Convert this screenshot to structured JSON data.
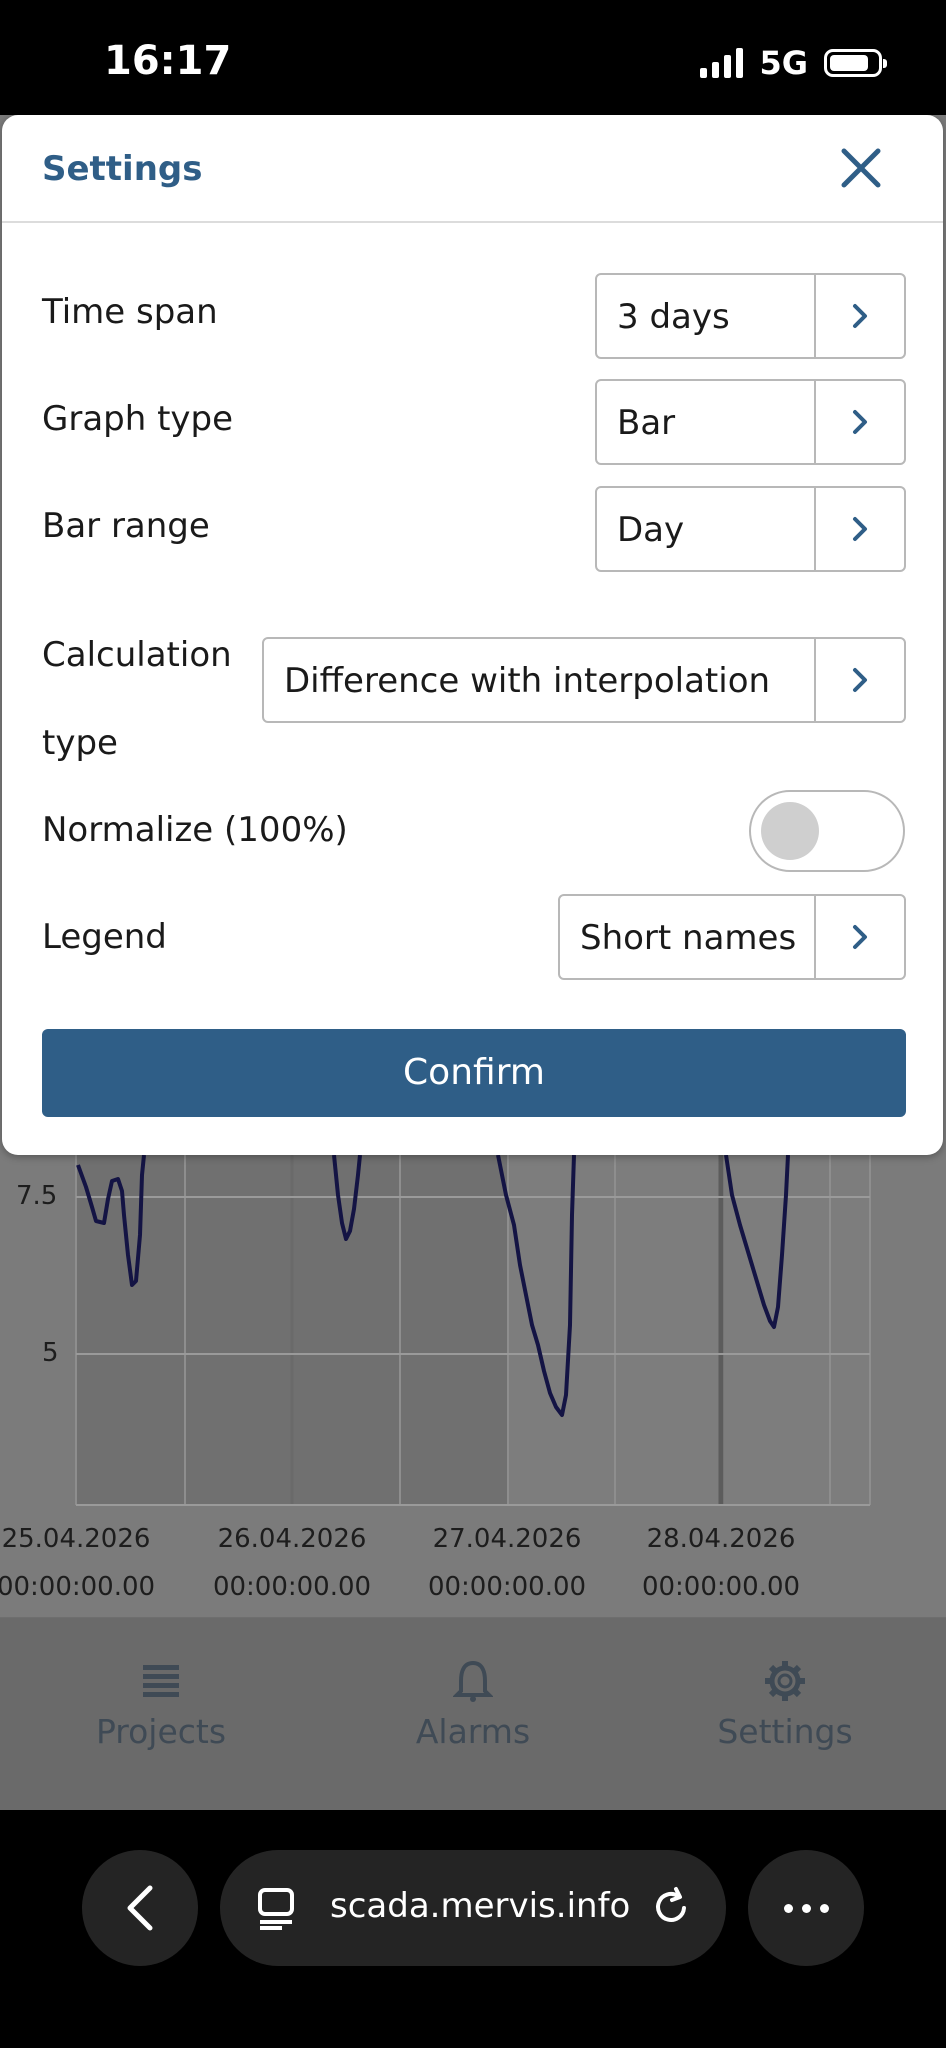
{
  "status_bar": {
    "time": "16:17",
    "network": "5G"
  },
  "settings_modal": {
    "title": "Settings",
    "rows": [
      {
        "label": "Time span",
        "value": "3 days"
      },
      {
        "label": "Graph type",
        "value": "Bar"
      },
      {
        "label": "Bar range",
        "value": "Day"
      },
      {
        "label": "Calculation type",
        "value": "Difference with interpolation"
      },
      {
        "label": "Normalize (100%)",
        "toggle_on": false
      },
      {
        "label": "Legend",
        "value": "Short names"
      }
    ],
    "confirm_label": "Confirm"
  },
  "chart": {
    "y_ticks": [
      "7.5",
      "5"
    ],
    "x_ticks": [
      {
        "date": "25.04.2026",
        "time": "00:00:00.00"
      },
      {
        "date": "26.04.2026",
        "time": "00:00:00.00"
      },
      {
        "date": "27.04.2026",
        "time": "00:00:00.00"
      },
      {
        "date": "28.04.2026",
        "time": "00:00:00.00"
      }
    ],
    "line_color": "#141444"
  },
  "bottom_nav": {
    "items": [
      {
        "label": "Projects",
        "icon": "list-icon"
      },
      {
        "label": "Alarms",
        "icon": "bell-icon"
      },
      {
        "label": "Settings",
        "icon": "gear-icon"
      }
    ]
  },
  "browser": {
    "url": "scada.mervis.info"
  },
  "colors": {
    "accent": "#2f5e87",
    "overlay": "#7b7b7b"
  }
}
